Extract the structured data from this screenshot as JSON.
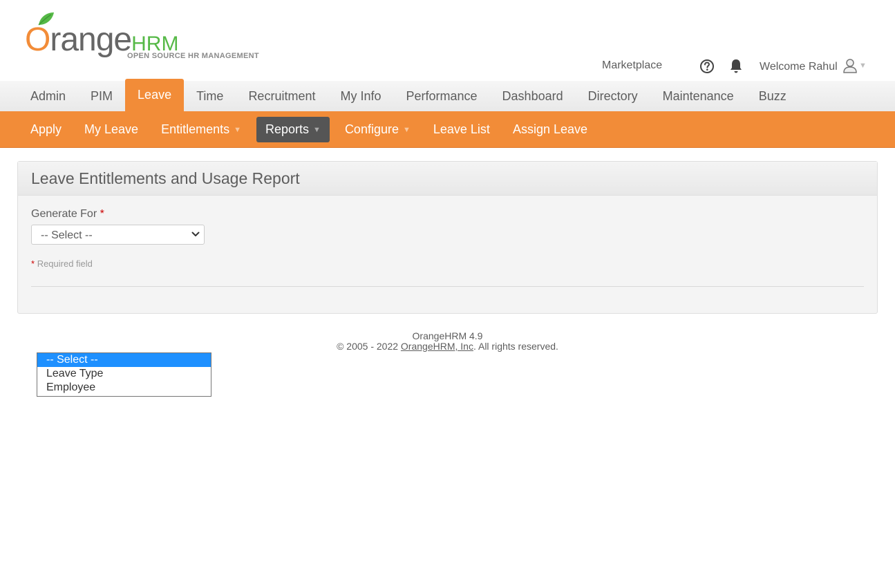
{
  "logo": {
    "brand_prefix": "O",
    "brand_mid": "range",
    "brand_suffix": "HRM",
    "tagline": "OPEN SOURCE HR MANAGEMENT"
  },
  "top_bar": {
    "marketplace": "Marketplace",
    "welcome": "Welcome Rahul"
  },
  "main_menu": {
    "items": [
      "Admin",
      "PIM",
      "Leave",
      "Time",
      "Recruitment",
      "My Info",
      "Performance",
      "Dashboard",
      "Directory",
      "Maintenance",
      "Buzz"
    ],
    "active": "Leave"
  },
  "sub_menu": {
    "items": [
      "Apply",
      "My Leave",
      "Entitlements",
      "Reports",
      "Configure",
      "Leave List",
      "Assign Leave"
    ],
    "active": "Reports"
  },
  "report": {
    "title": "Leave Entitlements and Usage Report",
    "generate_for_label": "Generate For",
    "required_mark": "*",
    "select_value": "-- Select --",
    "required_note": "Required field"
  },
  "dropdown": {
    "options": [
      "-- Select --",
      "Leave Type",
      "Employee"
    ],
    "selected": "-- Select --"
  },
  "footer": {
    "version": "OrangeHRM 4.9",
    "copyright_prefix": "© 2005 - 2022 ",
    "company_link": "OrangeHRM, Inc",
    "copyright_suffix": ". All rights reserved."
  },
  "colors": {
    "brand_orange": "#f28c38",
    "brand_green": "#56b947",
    "active_submenu": "#555555",
    "dropdown_highlight": "#1e90ff"
  }
}
